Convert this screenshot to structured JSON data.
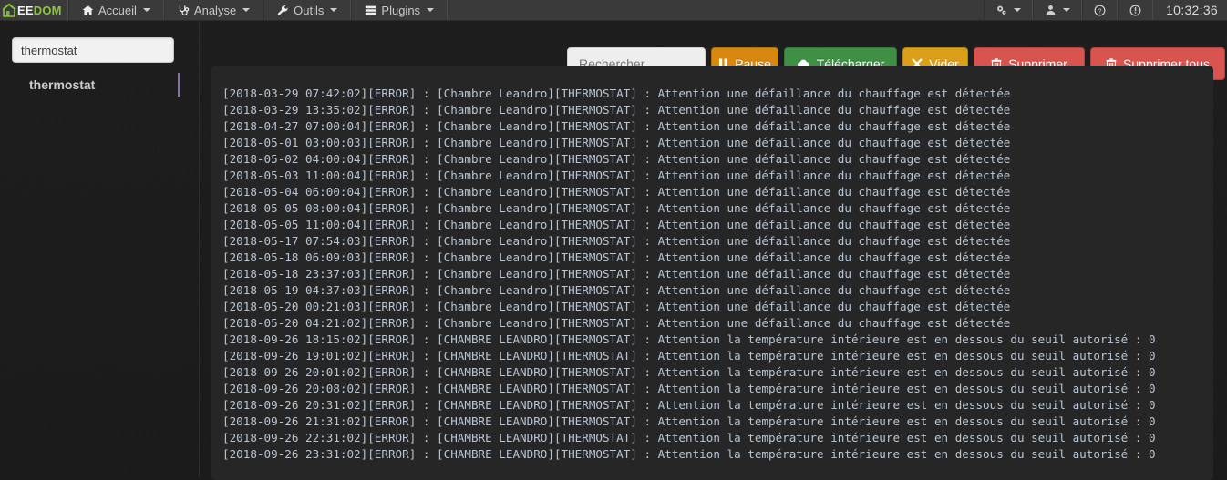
{
  "brand": {
    "name_white": "EE",
    "name_green": "DOM",
    "icon": "house-icon"
  },
  "navbar": {
    "items": [
      {
        "label": "Accueil",
        "icon": "home-icon",
        "caret": true
      },
      {
        "label": "Analyse",
        "icon": "stethoscope-icon",
        "caret": true
      },
      {
        "label": "Outils",
        "icon": "wrench-icon",
        "caret": true
      },
      {
        "label": "Plugins",
        "icon": "server-icon",
        "caret": true
      }
    ],
    "right_items": [
      {
        "label": "",
        "icon": "gears-icon",
        "caret": true
      },
      {
        "label": "",
        "icon": "user-icon",
        "caret": true
      },
      {
        "label": "",
        "icon": "question-circle-icon",
        "caret": false
      },
      {
        "label": "",
        "icon": "exclamation-circle-icon",
        "caret": false
      }
    ],
    "clock": "10:32:36"
  },
  "sidebar": {
    "search_value": "thermostat",
    "search_placeholder": "",
    "items": [
      {
        "label": "thermostat",
        "selected": true
      }
    ]
  },
  "toolbar": {
    "search_value": "",
    "search_placeholder": "Rechercher",
    "pause_label": "Pause",
    "pause_icon": "pause-icon",
    "download_label": "Télécharger",
    "download_icon": "cloud-download-icon",
    "clear_label": "Vider",
    "clear_icon": "times-icon",
    "delete_label": "Supprimer",
    "delete_icon": "trash-icon",
    "delete_all_label": "Supprimer tous",
    "delete_all_icon": "trash-icon",
    "colors": {
      "orange": "#d8880f",
      "green": "#3f8f45",
      "yellow": "#dba018",
      "red": "#d9534f",
      "accent_purple": "#8a6fb0"
    }
  },
  "log": {
    "lines": [
      "[2018-03-29 07:42:02][ERROR] : [Chambre Leandro][THERMOSTAT] : Attention une défaillance du chauffage est détectée",
      "[2018-03-29 13:35:02][ERROR] : [Chambre Leandro][THERMOSTAT] : Attention une défaillance du chauffage est détectée",
      "[2018-04-27 07:00:04][ERROR] : [Chambre Leandro][THERMOSTAT] : Attention une défaillance du chauffage est détectée",
      "[2018-05-01 03:00:03][ERROR] : [Chambre Leandro][THERMOSTAT] : Attention une défaillance du chauffage est détectée",
      "[2018-05-02 04:00:04][ERROR] : [Chambre Leandro][THERMOSTAT] : Attention une défaillance du chauffage est détectée",
      "[2018-05-03 11:00:04][ERROR] : [Chambre Leandro][THERMOSTAT] : Attention une défaillance du chauffage est détectée",
      "[2018-05-04 06:00:04][ERROR] : [Chambre Leandro][THERMOSTAT] : Attention une défaillance du chauffage est détectée",
      "[2018-05-05 08:00:04][ERROR] : [Chambre Leandro][THERMOSTAT] : Attention une défaillance du chauffage est détectée",
      "[2018-05-05 11:00:04][ERROR] : [Chambre Leandro][THERMOSTAT] : Attention une défaillance du chauffage est détectée",
      "[2018-05-17 07:54:03][ERROR] : [Chambre Leandro][THERMOSTAT] : Attention une défaillance du chauffage est détectée",
      "[2018-05-18 06:09:03][ERROR] : [Chambre Leandro][THERMOSTAT] : Attention une défaillance du chauffage est détectée",
      "[2018-05-18 23:37:03][ERROR] : [Chambre Leandro][THERMOSTAT] : Attention une défaillance du chauffage est détectée",
      "[2018-05-19 04:37:03][ERROR] : [Chambre Leandro][THERMOSTAT] : Attention une défaillance du chauffage est détectée",
      "[2018-05-20 00:21:03][ERROR] : [Chambre Leandro][THERMOSTAT] : Attention une défaillance du chauffage est détectée",
      "[2018-05-20 04:21:02][ERROR] : [Chambre Leandro][THERMOSTAT] : Attention une défaillance du chauffage est détectée",
      "[2018-09-26 18:15:02][ERROR] : [CHAMBRE LEANDRO][THERMOSTAT] : Attention la température intérieure est en dessous du seuil autorisé : 0",
      "[2018-09-26 19:01:02][ERROR] : [CHAMBRE LEANDRO][THERMOSTAT] : Attention la température intérieure est en dessous du seuil autorisé : 0",
      "[2018-09-26 20:01:02][ERROR] : [CHAMBRE LEANDRO][THERMOSTAT] : Attention la température intérieure est en dessous du seuil autorisé : 0",
      "[2018-09-26 20:08:02][ERROR] : [CHAMBRE LEANDRO][THERMOSTAT] : Attention la température intérieure est en dessous du seuil autorisé : 0",
      "[2018-09-26 20:31:02][ERROR] : [CHAMBRE LEANDRO][THERMOSTAT] : Attention la température intérieure est en dessous du seuil autorisé : 0",
      "[2018-09-26 21:31:02][ERROR] : [CHAMBRE LEANDRO][THERMOSTAT] : Attention la température intérieure est en dessous du seuil autorisé : 0",
      "[2018-09-26 22:31:02][ERROR] : [CHAMBRE LEANDRO][THERMOSTAT] : Attention la température intérieure est en dessous du seuil autorisé : 0",
      "[2018-09-26 23:31:02][ERROR] : [CHAMBRE LEANDRO][THERMOSTAT] : Attention la température intérieure est en dessous du seuil autorisé : 0"
    ]
  }
}
